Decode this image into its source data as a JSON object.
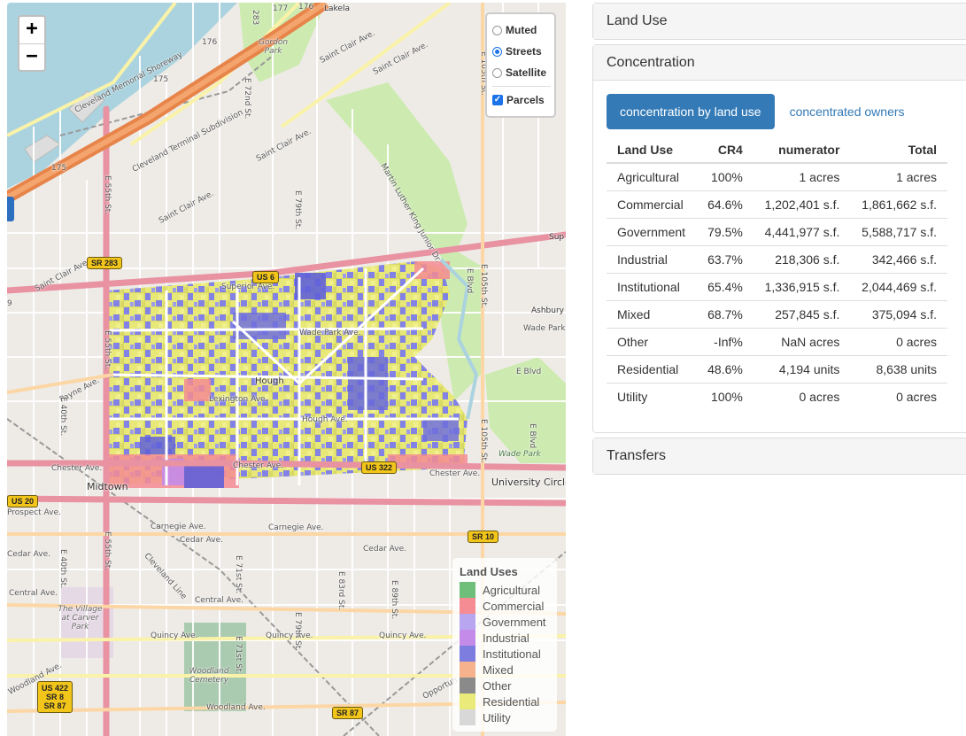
{
  "map": {
    "zoom_in": "+",
    "zoom_out": "−",
    "layers": {
      "base": [
        {
          "label": "Muted",
          "selected": false
        },
        {
          "label": "Streets",
          "selected": true
        },
        {
          "label": "Satellite",
          "selected": false
        }
      ],
      "overlay": {
        "label": "Parcels",
        "checked": true,
        "check_glyph": "✓"
      }
    },
    "legend": {
      "title": "Land Uses",
      "items": [
        {
          "label": "Agricultural",
          "color": "#6fbf7a"
        },
        {
          "label": "Commercial",
          "color": "#f58b93"
        },
        {
          "label": "Government",
          "color": "#b9a6f0"
        },
        {
          "label": "Industrial",
          "color": "#c48ce8"
        },
        {
          "label": "Institutional",
          "color": "#7d7de0"
        },
        {
          "label": "Mixed",
          "color": "#f5b28c"
        },
        {
          "label": "Other",
          "color": "#8a8a8a"
        },
        {
          "label": "Residential",
          "color": "#eaea7a"
        },
        {
          "label": "Utility",
          "color": "#d8d8d8"
        }
      ]
    },
    "shields": {
      "sr283": "SR 283",
      "us6": "US 6",
      "us322": "US 322",
      "us20": "US 20",
      "sr10": "SR 10",
      "sr87": "SR 87",
      "stack": [
        "US 422",
        "SR 8",
        "SR 87"
      ],
      "r177": "177",
      "r176": "176",
      "r176b": "176",
      "r175": "175",
      "r175b": "175",
      "r283": "283"
    },
    "places": {
      "midtown": "Midtown",
      "university_circle": "University Circle",
      "gordon_park": "Gordon Park",
      "village": "The Village at Carver Park",
      "woodland_cemetery": "Woodland Cemetery",
      "wade_park": "Wade Park",
      "hough": "Hough",
      "lakeland": "Lakela",
      "ashbury": "Ashbury",
      "sup": "Sup"
    },
    "roads": {
      "memorial": "Cleveland Memorial Shoreway",
      "terminal": "Cleveland Terminal Subdivision",
      "st_clair1": "Saint Clair Ave.",
      "st_clair2": "Saint Clair Ave.",
      "st_clair3": "Saint Clair Ave.",
      "st_clair4": "Saint Clair Ave.",
      "st_clair5": "Saint Clair Ave.",
      "superior": "Superior Ave.",
      "wade_park": "Wade Park Ave.",
      "wade_park2": "Wade Park Ave",
      "hough": "Hough Ave.",
      "lexington": "Lexington Ave.",
      "payne": "Payne Ave.",
      "chester": "Chester Ave.",
      "chester2": "Chester Ave.",
      "chester3": "Chester Ave.",
      "carnegie": "Carnegie Ave.",
      "carnegie2": "Carnegie Ave.",
      "cedar": "Cedar Ave.",
      "cedar2": "Cedar Ave.",
      "cedar3": "Cedar Ave.",
      "prospect": "Prospect Ave.",
      "central": "Central Ave.",
      "central2": "Central Ave.",
      "quincy": "Quincy Ave.",
      "quincy2": "Quincy Ave.",
      "quincy3": "Quincy Ave.",
      "woodland": "Woodland Ave.",
      "woodland2": "Woodland Ave.",
      "e55": "E 55th St.",
      "e55b": "E 55th St.",
      "e55c": "E 55th St.",
      "e72": "E 72nd St.",
      "e79": "E 79th St.",
      "e79b": "E 79th St.",
      "e105": "E 105th St.",
      "e105b": "E 105th St.",
      "e105c": "E 105th St.",
      "e40": "E 40th St.",
      "e40b": "E 40th St.",
      "e71": "E 71st St.",
      "e71b": "E 71st St.",
      "e83": "E 83rd St.",
      "e89": "E 89th St.",
      "mlk": "Martin Luther King Junior Dr.",
      "eblvd": "E Blvd",
      "eblvd2": "E Blvd",
      "eblvd3": "E Blvd",
      "cleveland_line": "Cleveland Line",
      "route9": "9",
      "opportunity": "Opportun"
    }
  },
  "panel": {
    "sections": {
      "land_use": "Land Use",
      "concentration": "Concentration",
      "transfers": "Transfers"
    },
    "tabs": {
      "active": "concentration by land use",
      "other": "concentrated owners"
    },
    "table": {
      "headers": [
        "Land Use",
        "CR4",
        "numerator",
        "Total"
      ],
      "rows": [
        [
          "Agricultural",
          "100%",
          "1 acres",
          "1 acres"
        ],
        [
          "Commercial",
          "64.6%",
          "1,202,401 s.f.",
          "1,861,662 s.f."
        ],
        [
          "Government",
          "79.5%",
          "4,441,977 s.f.",
          "5,588,717 s.f."
        ],
        [
          "Industrial",
          "63.7%",
          "218,306 s.f.",
          "342,466 s.f."
        ],
        [
          "Institutional",
          "65.4%",
          "1,336,915 s.f.",
          "2,044,469 s.f."
        ],
        [
          "Mixed",
          "68.7%",
          "257,845 s.f.",
          "375,094 s.f."
        ],
        [
          "Other",
          "-Inf%",
          "NaN acres",
          "0 acres"
        ],
        [
          "Residential",
          "48.6%",
          "4,194 units",
          "8,638 units"
        ],
        [
          "Utility",
          "100%",
          "0 acres",
          "0 acres"
        ]
      ]
    }
  }
}
